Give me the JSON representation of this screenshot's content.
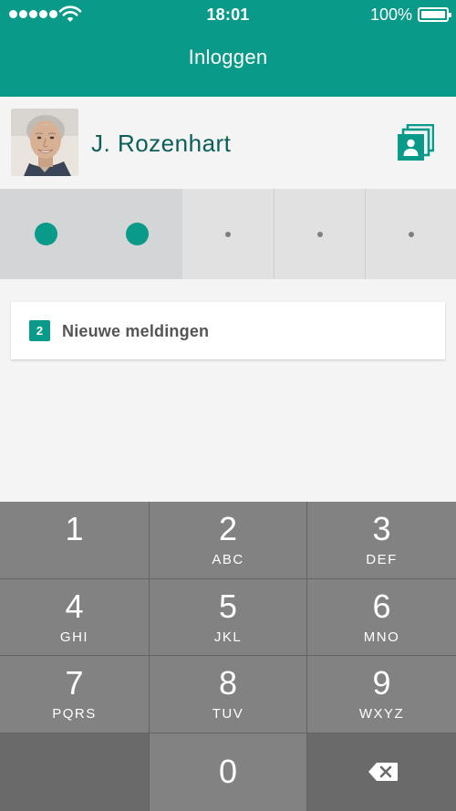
{
  "status_bar": {
    "time": "18:01",
    "battery": "100%",
    "signal_bars": 5,
    "icons": [
      "signal-dots-icon",
      "wifi-icon",
      "battery-icon"
    ]
  },
  "header": {
    "title": "Inloggen"
  },
  "user": {
    "name": "J. Rozenhart",
    "avatar_icon": "avatar-photo",
    "switch_icon": "accounts-stack-icon"
  },
  "pin": {
    "total_digits": 5,
    "entered_digits": 2
  },
  "notifications": {
    "count": "2",
    "label": "Nieuwe meldingen"
  },
  "keypad": {
    "keys": [
      {
        "digit": "1",
        "letters": ""
      },
      {
        "digit": "2",
        "letters": "ABC"
      },
      {
        "digit": "3",
        "letters": "DEF"
      },
      {
        "digit": "4",
        "letters": "GHI"
      },
      {
        "digit": "5",
        "letters": "JKL"
      },
      {
        "digit": "6",
        "letters": "MNO"
      },
      {
        "digit": "7",
        "letters": "PQRS"
      },
      {
        "digit": "8",
        "letters": "TUV"
      },
      {
        "digit": "9",
        "letters": "WXYZ"
      },
      {
        "digit": "0",
        "letters": ""
      }
    ],
    "backspace_icon": "backspace-icon"
  },
  "colors": {
    "brand": "#0a9a89",
    "name_text": "#0b5f58",
    "key": "#828282",
    "key_dark": "#6a6a6a"
  }
}
